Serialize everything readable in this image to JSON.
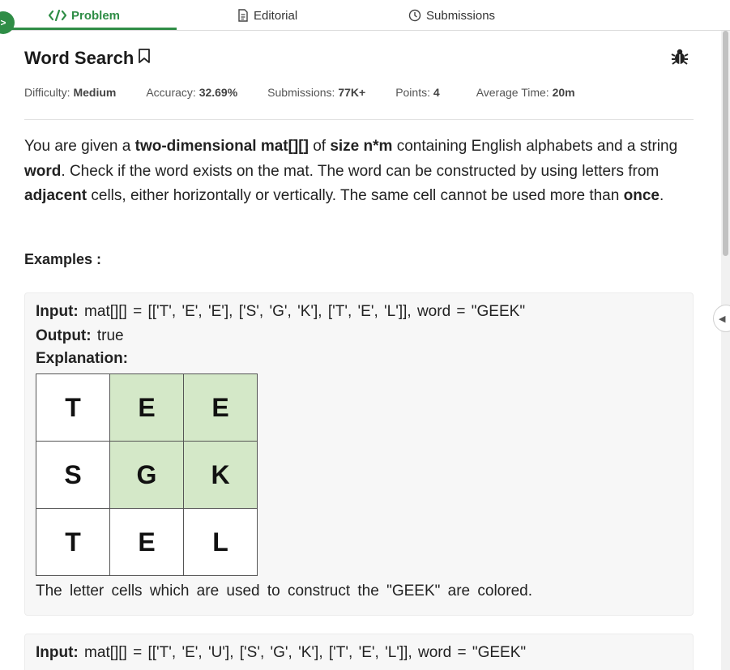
{
  "tabs": [
    {
      "label": "Problem",
      "icon": "code-icon",
      "active": true
    },
    {
      "label": "Editorial",
      "icon": "document-icon",
      "active": false
    },
    {
      "label": "Submissions",
      "icon": "clock-icon",
      "active": false
    }
  ],
  "problem": {
    "title": "Word Search",
    "meta": {
      "difficulty_label": "Difficulty:",
      "difficulty": "Medium",
      "accuracy_label": "Accuracy:",
      "accuracy": "32.69%",
      "submissions_label": "Submissions:",
      "submissions": "77K+",
      "points_label": "Points:",
      "points": "4",
      "time_label": "Average Time:",
      "time": "20m"
    },
    "desc": {
      "p1": "You are given a ",
      "b1": "two-dimensional mat[][]",
      "p2": " of ",
      "b2": "size n*m",
      "p3": " containing English alphabets and a string ",
      "b3": "word",
      "p4": ". Check if the word exists on the mat. The word can be constructed by using letters from ",
      "b4": "adjacent",
      "p5": " cells, either horizontally or vertically. The same cell cannot be used more than ",
      "b5": "once",
      "p6": "."
    },
    "examples_heading": "Examples :"
  },
  "example1": {
    "input_label": "Input:",
    "input": "mat[][] = [['T', 'E', 'E'], ['S', 'G', 'K'], ['T', 'E', 'L']], word = \"GEEK\"",
    "output_label": "Output:",
    "output": "true",
    "explanation_label": "Explanation:",
    "grid": [
      [
        "T",
        "E",
        "E"
      ],
      [
        "S",
        "G",
        "K"
      ],
      [
        "T",
        "E",
        "L"
      ]
    ],
    "highlight": [
      [
        false,
        true,
        true
      ],
      [
        false,
        true,
        true
      ],
      [
        false,
        false,
        false
      ]
    ],
    "note": "The letter cells which are used to construct the \"GEEK\" are colored."
  },
  "example2": {
    "input_label": "Input:",
    "input": "mat[][] = [['T', 'E', 'U'], ['S', 'G', 'K'], ['T', 'E', 'L']], word = \"GEEK\""
  },
  "colors": {
    "accent": "#2f8d46",
    "highlight_cell": "#d4e8c8"
  }
}
